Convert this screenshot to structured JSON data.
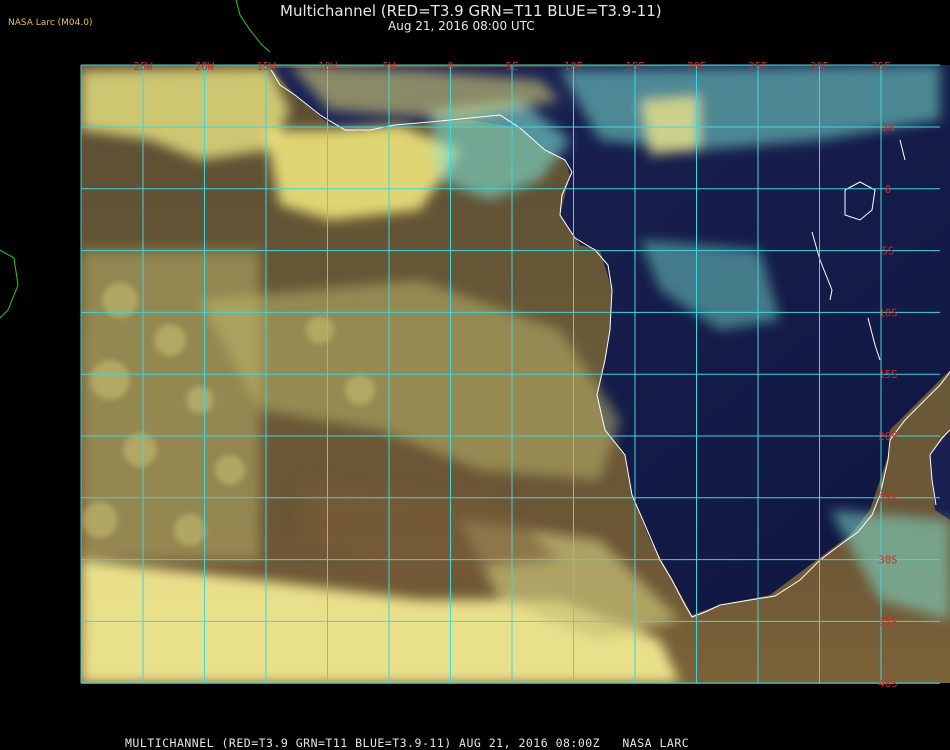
{
  "header": {
    "credit": "NASA Larc (M04.0)",
    "title": "Multichannel (RED=T3.9 GRN=T11 BLUE=T3.9-11)",
    "datetime": "Aug 21, 2016 08:00 UTC"
  },
  "footer": {
    "caption": "MULTICHANNEL (RED=T3.9 GRN=T11 BLUE=T3.9-11) AUG 21, 2016 08:00Z   NASA LARC"
  },
  "grid": {
    "color": "#3fd6dc",
    "label_color": "#c8302a",
    "longitudes": [
      "25W",
      "20W",
      "15W",
      "10W",
      "5W",
      "0",
      "5E",
      "10E",
      "15E",
      "20E",
      "25E",
      "30E",
      "35E"
    ],
    "latitudes": [
      "5N",
      "0",
      "5S",
      "10S",
      "15S",
      "20S",
      "25S",
      "30S",
      "35S",
      "40S"
    ]
  },
  "colors": {
    "background": "#000000",
    "coastline": "#ffffff",
    "land_night": "#141b4a",
    "ocean": "#5a4a34",
    "cloud": "#e6df78",
    "thin_cloud_cyan": "#6fe3cf"
  }
}
